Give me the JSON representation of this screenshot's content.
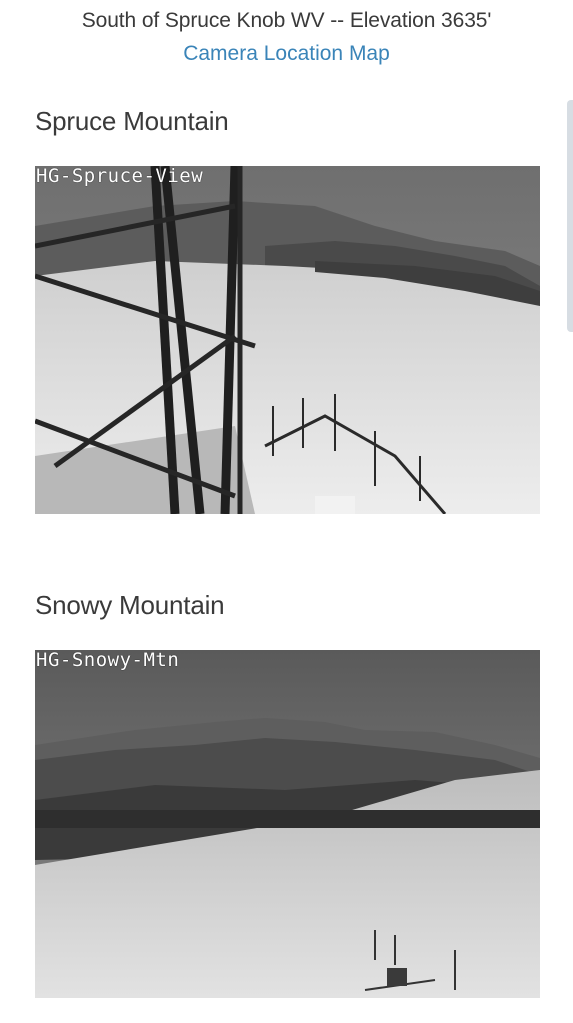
{
  "header": {
    "location": "South of Spruce Knob WV -- Elevation 3635'",
    "map_link": "Camera Location Map"
  },
  "cameras": [
    {
      "title": "Spruce Mountain",
      "overlay": "HG-Spruce-View"
    },
    {
      "title": "Snowy Mountain",
      "overlay": "HG-Snowy-Mtn"
    }
  ]
}
